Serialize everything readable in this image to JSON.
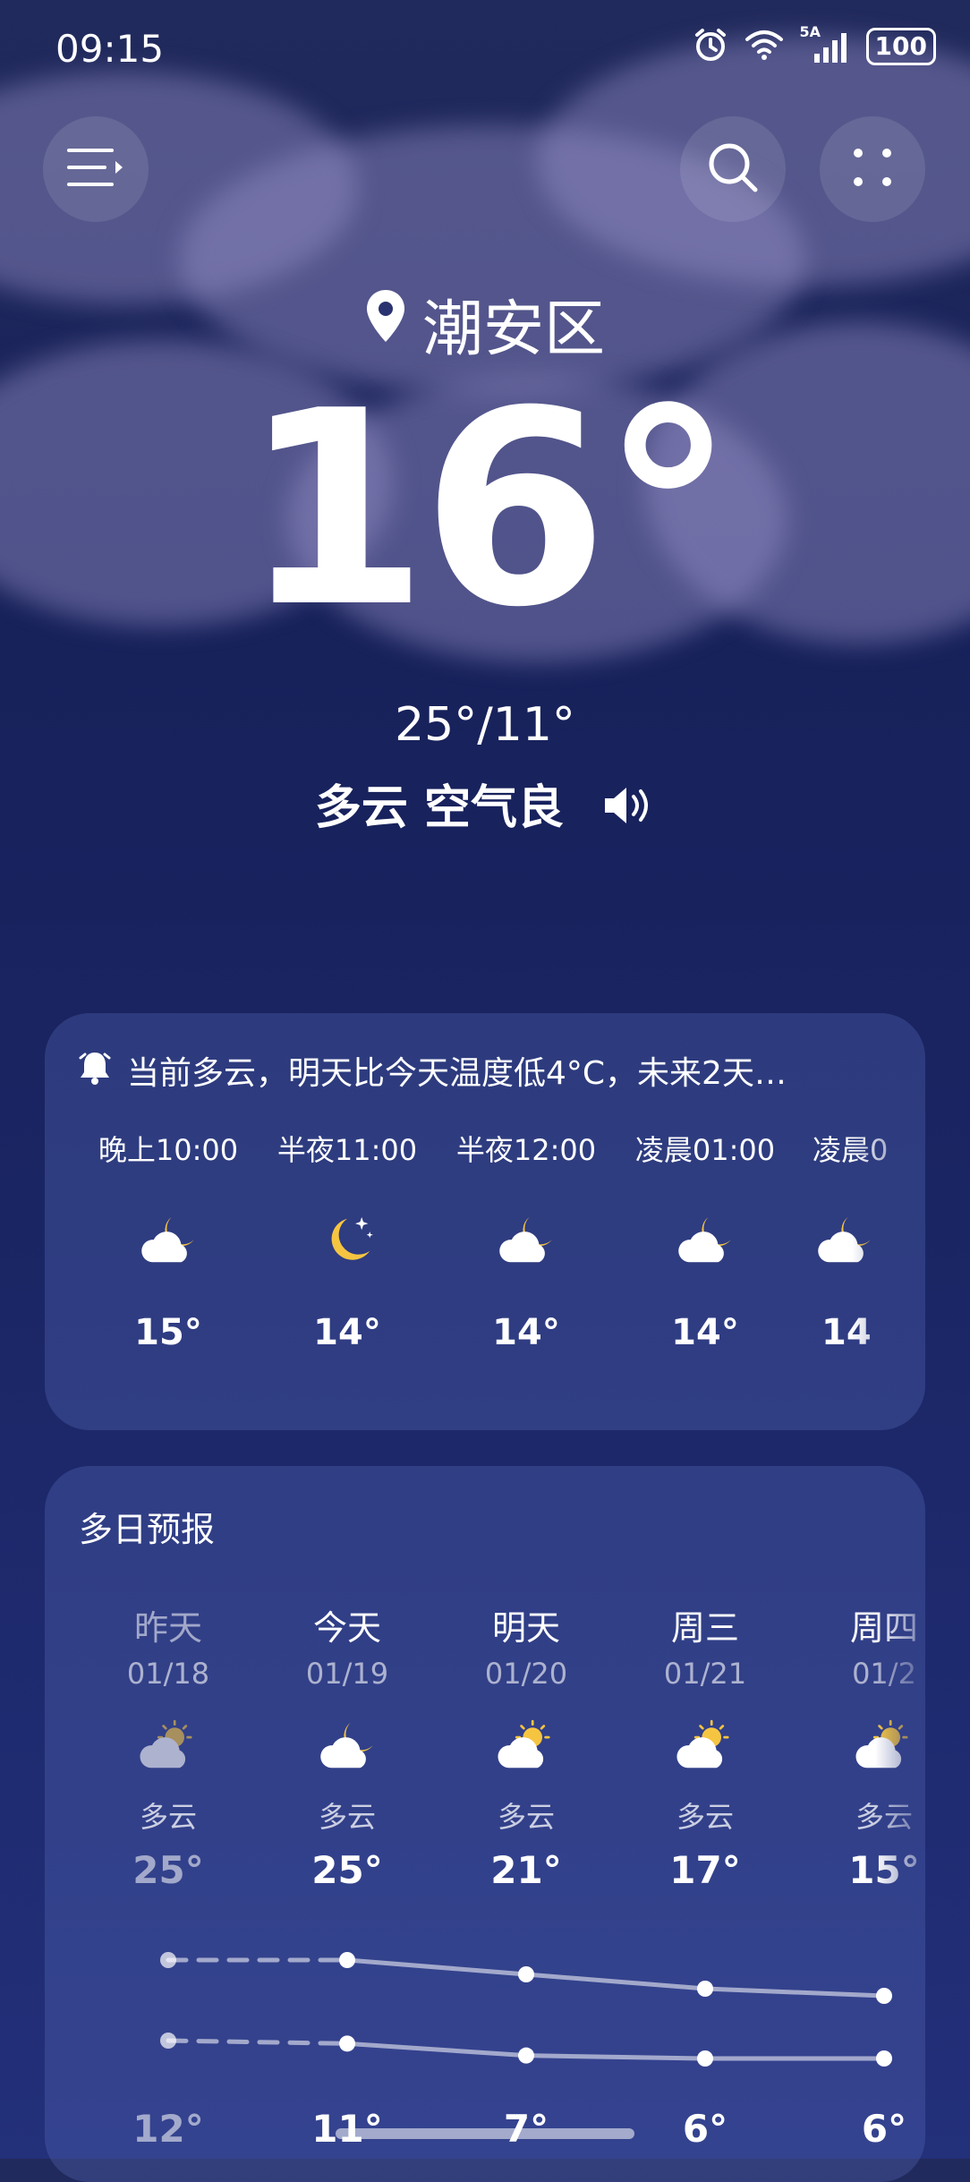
{
  "status_bar": {
    "time": "09:15",
    "network": "5A",
    "battery": "100",
    "icons": [
      "alarm-icon",
      "wifi-icon",
      "signal-icon",
      "battery-icon"
    ]
  },
  "header": {
    "menu_icon": "menu-icon",
    "search_icon": "search-icon",
    "more_icon": "more-icon"
  },
  "current": {
    "location": "潮安区",
    "temperature": "16°",
    "range": "25°/11°",
    "condition": "多云 空气良",
    "speaker_icon": "speaker-icon"
  },
  "hourly": {
    "alert_icon": "alert-bell-icon",
    "alert": "当前多云，明天比今天温度低4°C，未来2天…",
    "items": [
      {
        "time": "晚上10:00",
        "icon": "cloudy-night-icon",
        "temp": "15°"
      },
      {
        "time": "半夜11:00",
        "icon": "clear-night-icon",
        "temp": "14°"
      },
      {
        "time": "半夜12:00",
        "icon": "cloudy-night-icon",
        "temp": "14°"
      },
      {
        "time": "凌晨01:00",
        "icon": "cloudy-night-icon",
        "temp": "14°"
      },
      {
        "time": "凌晨0",
        "icon": "cloudy-night-icon",
        "temp": "14"
      }
    ]
  },
  "daily": {
    "title": "多日预报",
    "items": [
      {
        "day": "昨天",
        "date": "01/18",
        "icon": "partly-cloudy-icon",
        "condition": "多云",
        "high": "25°",
        "low": "12°"
      },
      {
        "day": "今天",
        "date": "01/19",
        "icon": "cloudy-night-icon",
        "condition": "多云",
        "high": "25°",
        "low": "11°"
      },
      {
        "day": "明天",
        "date": "01/20",
        "icon": "partly-cloudy-icon",
        "condition": "多云",
        "high": "21°",
        "low": "7°"
      },
      {
        "day": "周三",
        "date": "01/21",
        "icon": "partly-cloudy-icon",
        "condition": "多云",
        "high": "17°",
        "low": "6°"
      },
      {
        "day": "周四",
        "date": "01/2",
        "icon": "partly-cloudy-icon",
        "condition": "多云",
        "high": "15°",
        "low": "6°"
      }
    ]
  },
  "colors": {
    "background_top": "#212a5c",
    "background_bottom": "#23307a",
    "card": "#3b4a8c",
    "sun": "#f5c542",
    "cloud": "#ffffff"
  }
}
